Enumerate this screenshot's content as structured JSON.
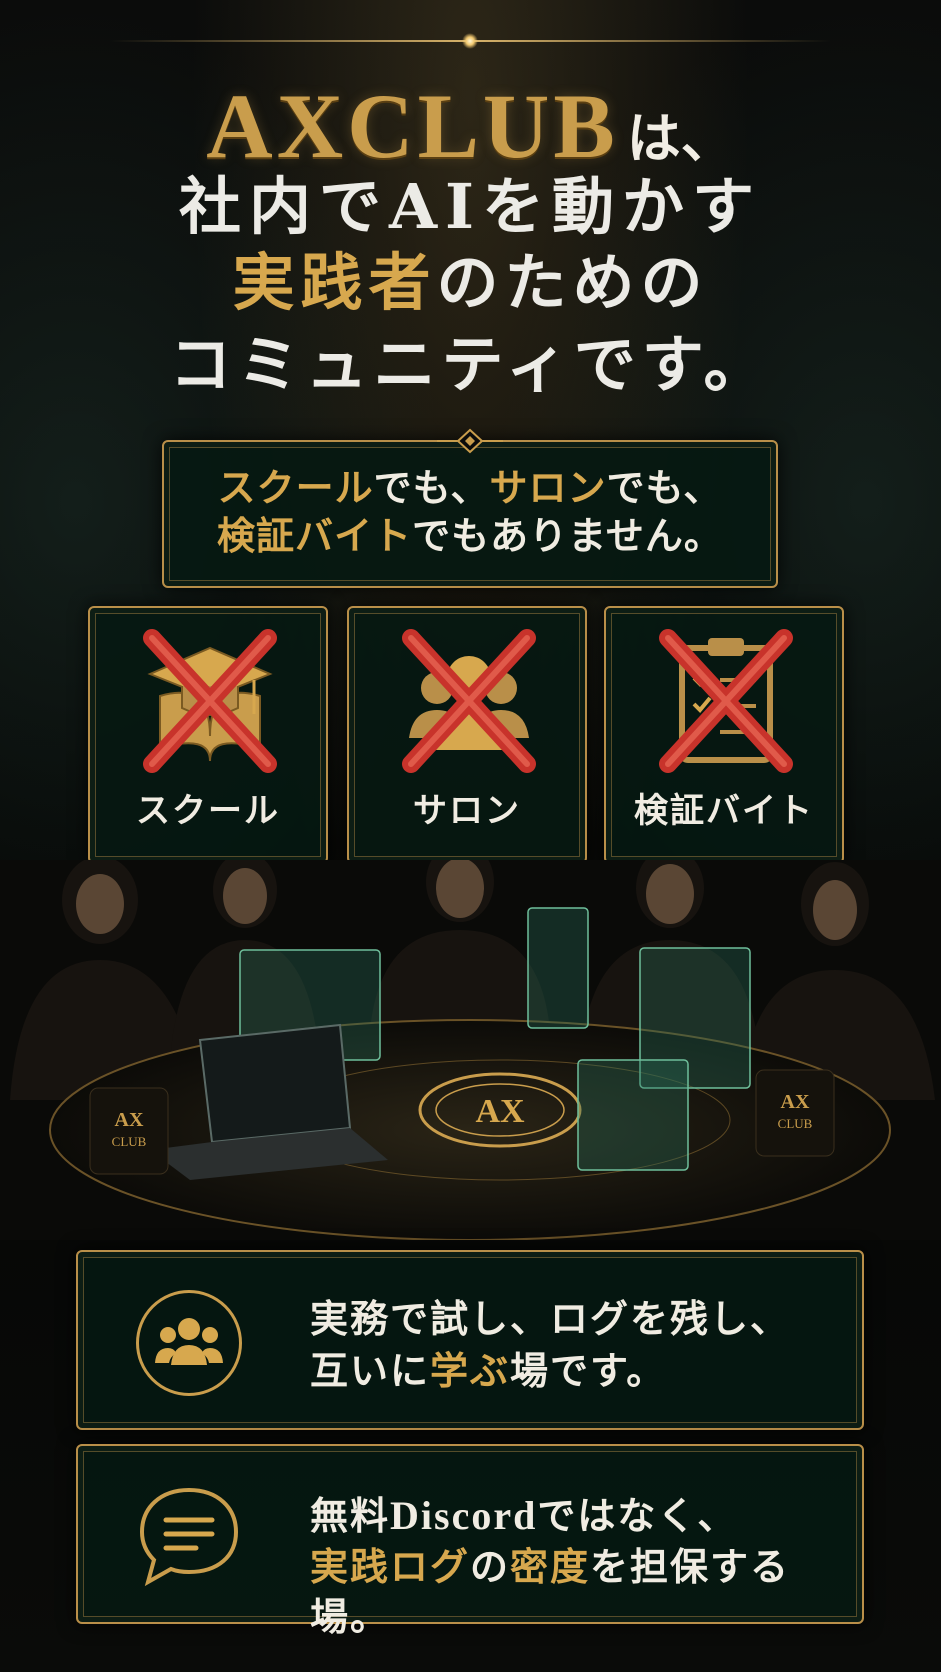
{
  "headline": {
    "brand": "AXCLUB",
    "line1_tail": "は、",
    "line2": "社内でAIを動かす",
    "line3_gold": "実践者",
    "line3_rest": "のための",
    "line4": "コミュニティです。"
  },
  "notice": {
    "l1_gold_a": "スクール",
    "l1_white_a": "でも、",
    "l1_gold_b": "サロン",
    "l1_white_b": "でも、",
    "l2_gold": "検証バイト",
    "l2_white": "でもありません。"
  },
  "cards": [
    {
      "label": "スクール",
      "icon": "graduation-book-icon"
    },
    {
      "label": "サロン",
      "icon": "people-icon"
    },
    {
      "label": "検証バイト",
      "icon": "clipboard-checklist-icon"
    }
  ],
  "scene": {
    "table_logo": "AX",
    "mug_left": [
      "AX",
      "CLUB"
    ],
    "mug_right": [
      "AX",
      "CLUB"
    ]
  },
  "bars": [
    {
      "icon": "group-people-icon",
      "line1": "実務で試し、ログを残し、",
      "line2_a": "互いに",
      "line2_gold": "学ぶ",
      "line2_b": "場です。"
    },
    {
      "icon": "chat-bubble-icon",
      "line1_a": "無料",
      "line1_latin": "Discord",
      "line1_b": "ではなく、",
      "line2_gold_a": "実践ログ",
      "line2_white_a": "の",
      "line2_gold_b": "密度",
      "line2_white_b": "を担保する場。"
    }
  ],
  "colors": {
    "gold": "#d7a84e",
    "panel": "#061812",
    "cross": "#c8332b"
  }
}
